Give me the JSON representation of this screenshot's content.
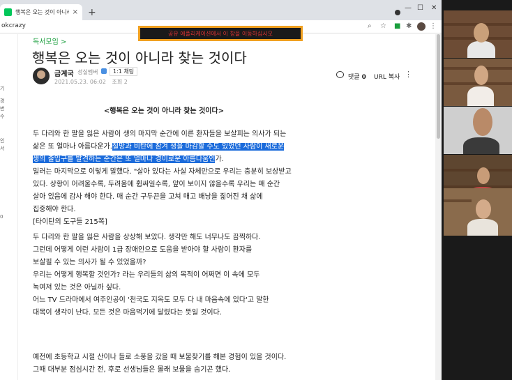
{
  "browser": {
    "tab_title": "행복은 오는 것이 아니라 찾는 것",
    "tab_close": "×",
    "new_tab": "+",
    "url_partial": "okcrazy",
    "window_controls": {
      "minimize": "—",
      "maximize": "☐",
      "close": "✕"
    }
  },
  "share_banner": {
    "text": "공유 애플리케이션에서 이 창을 이동하십시오"
  },
  "sidebar_fragments": [
    "기",
    "경",
    "변",
    "수",
    "인",
    "서",
    "0"
  ],
  "post": {
    "breadcrumb": "독서모임 >",
    "title": "행복은 오는 것이 아니라 찾는 것이다",
    "author": {
      "name": "금계국",
      "rank": "성실멤버",
      "chat_button": "1:1 채팅"
    },
    "date": "2021.05.23. 06:02",
    "views_label": "조회 2",
    "comments_label": "댓글",
    "comments_count": "0",
    "url_copy": "URL 복사",
    "more": "⋮",
    "heading": "<행복은 오는 것이 아니라 찾는 것이다>",
    "para1": [
      "두 다리와 한 팔을 잃은 사람이 생의 마지막 순간에 이른 환자들을 보살피는 의사가 되는",
      "삶은 또 얼마나 아름다운가.",
      "절망과 비탄에 잠겨 생을 마감할 수도 있었던 사람이 새로운",
      "생의 출입구를 발견하는 순간은 또 얼마나 경이로운 아름다움인",
      "가.",
      "밀러는 마지막으로 이렇게 말했다. \"살아 있다는 사실 자체만으로 우리는 충분히 보상받고",
      "있다. 상황이 어려울수록, 두려움에 휩싸일수록, 앞이 보이지 않을수록 우리는 매 순간",
      "살아 있음에 감사 해야 한다. 매 순간 구두끈을 고쳐 매고 배낭을 짊어진 채 삶에",
      "집중해야 한다.",
      "[타이탄의 도구들 215쪽]"
    ],
    "para2": [
      "두 다리와 한 팔을 잃은 사람을 상상해 보았다. 생각만 해도 너무나도 끔찍하다.",
      "그런데 어떻게 이런 사람이 1급 장애인으로 도움을 받아야 할 사람이 환자를",
      "보살필 수 있는 의사가 될 수 있었을까?",
      "우리는 어떻게 행복할 것인가? 라는 우리들의 삶의 목적이 어쩌면 이 속에 모두",
      "녹여져 있는 것은 아닐까 싶다.",
      "어느 TV 드라마에서 여주인공이 '천국도 지옥도 모두 다 내 마음속에 있다'고 말한",
      "대목이 생각이 난다. 모든 것은 마음먹기에 달렸다는 뜻일 것이다."
    ],
    "para3": [
      "예전에 초등학교 시절 산이나 들로 소풍을 갔을 때 보물찾기를 해본 경험이 있을 것이다.",
      "그때 대부분 점심시간 전, 후로 선생님들은 몰래 보물을 숨기곤 했다."
    ]
  },
  "colors": {
    "accent": "#1a9e3d",
    "highlight": "#1b6bdb",
    "banner_border": "#f0a020"
  }
}
